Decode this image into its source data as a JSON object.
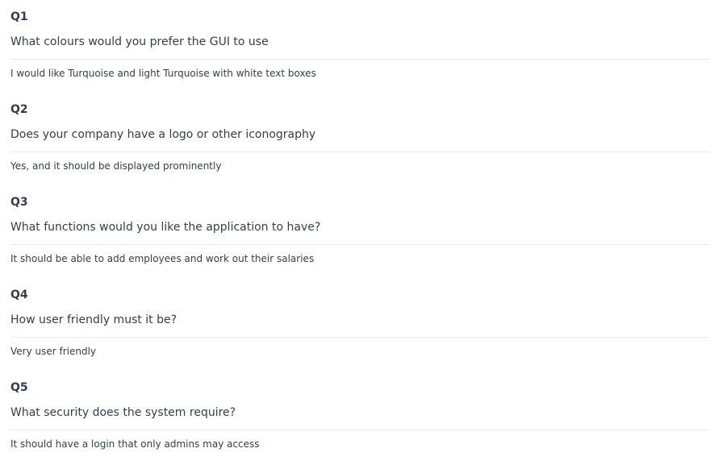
{
  "questions": [
    {
      "number": "Q1",
      "text": "What colours would you prefer the GUI to use",
      "answer": "I would like Turquoise and light Turquoise with white text boxes"
    },
    {
      "number": "Q2",
      "text": "Does your company have a logo or other iconography",
      "answer": "Yes, and it should be displayed prominently"
    },
    {
      "number": "Q3",
      "text": "What functions would you like the application to have?",
      "answer": "It should be able to add employees and work out their salaries"
    },
    {
      "number": "Q4",
      "text": "How user friendly must it be?",
      "answer": "Very user friendly"
    },
    {
      "number": "Q5",
      "text": "What security does the system require?",
      "answer": "It should have a login that only admins may access"
    }
  ]
}
